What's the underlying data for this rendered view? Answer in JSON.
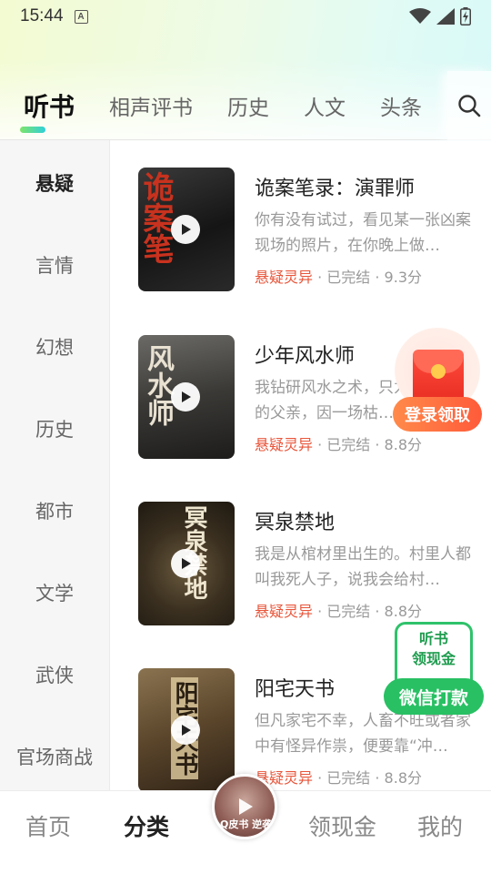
{
  "status_bar": {
    "time": "15:44",
    "notification_letter": "A"
  },
  "tabs": [
    {
      "label": "听书",
      "active": true
    },
    {
      "label": "相声评书",
      "active": false
    },
    {
      "label": "历史",
      "active": false
    },
    {
      "label": "人文",
      "active": false
    },
    {
      "label": "头条",
      "active": false
    }
  ],
  "sidebar": {
    "items": [
      {
        "label": "悬疑",
        "active": true
      },
      {
        "label": "言情"
      },
      {
        "label": "幻想"
      },
      {
        "label": "历史"
      },
      {
        "label": "都市"
      },
      {
        "label": "文学"
      },
      {
        "label": "武侠"
      },
      {
        "label": "官场商战"
      }
    ]
  },
  "books": [
    {
      "title": "诡案笔录：演罪师",
      "desc": "你有没有试过，看见某一张凶案现场的照片，在你晚上做…",
      "genre": "悬疑灵异",
      "status": " · 已完结 · ",
      "score": "9.3分",
      "cover_text": "诡案笔"
    },
    {
      "title": "少年风水师",
      "desc": "我钻研风水之术，只为寻找失踪的父亲，因一场枯…",
      "genre": "悬疑灵异",
      "status": " · 已完结 · ",
      "score": "8.8分",
      "cover_text": "风水师"
    },
    {
      "title": "冥泉禁地",
      "desc": "我是从棺材里出生的。村里人都叫我死人子，说我会给村…",
      "genre": "悬疑灵异",
      "status": " · 已完结 · ",
      "score": "8.8分",
      "cover_text": "冥泉禁地"
    },
    {
      "title": "阳宅天书",
      "desc": "但凡家宅不幸，人畜不旺或者家中有怪异作祟，便要靠“冲…",
      "genre": "悬疑灵异",
      "status": " · 已完结 · ",
      "score": "8.8分",
      "cover_text": "阳宅天书"
    }
  ],
  "float_red": {
    "label": "登录领取"
  },
  "float_wechat": {
    "line1": "听书",
    "line2": "领现金",
    "button": "微信打款"
  },
  "bottom_nav": [
    {
      "label": "首页",
      "active": false
    },
    {
      "label": "分类",
      "active": true
    },
    {
      "label": "领现金",
      "active": false
    },
    {
      "label": "我的",
      "active": false
    }
  ],
  "center_play_text": "Q皮书 逆袭"
}
